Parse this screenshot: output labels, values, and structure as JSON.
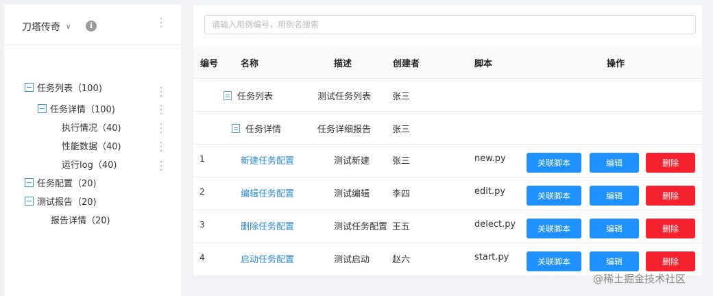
{
  "project": {
    "name": "刀塔传奇",
    "chevron_icon": "chevron-down-icon",
    "info_icon": "info-icon"
  },
  "tree": [
    {
      "label": "任务列表（100)",
      "toggle": "collapse-icon"
    },
    {
      "label": "任务详情（100)",
      "toggle": "collapse-icon"
    },
    {
      "label": "执行情况（40)"
    },
    {
      "label": "性能数据（40)"
    },
    {
      "label": "运行log（40)"
    },
    {
      "label": "任务配置（20)",
      "toggle": "collapse-icon"
    },
    {
      "label": "测试报告（20)",
      "toggle": "collapse-icon"
    },
    {
      "label": "报告详情（20)"
    }
  ],
  "search": {
    "placeholder": "请输入用例编号，用例名搜索",
    "value": ""
  },
  "table": {
    "headers": [
      "编号",
      "名称",
      "描述",
      "创建者",
      "脚本",
      "操作"
    ],
    "folder_rows": [
      {
        "name": "任务列表",
        "desc": "测试任务列表",
        "creator": "张三"
      },
      {
        "name": "任务详情",
        "desc": "任务详细报告",
        "creator": "张三"
      }
    ],
    "rows": [
      {
        "id": "1",
        "name": "新建任务配置",
        "desc": "测试新建",
        "creator": "张三",
        "script": "new.py"
      },
      {
        "id": "2",
        "name": "编辑任务配置",
        "desc": "测试编辑",
        "creator": "李四",
        "script": "edit.py"
      },
      {
        "id": "3",
        "name": "删除任务配置",
        "desc": "测试任务配置",
        "creator": "王五",
        "script": "delect.py"
      },
      {
        "id": "4",
        "name": "启动任务配置",
        "desc": "测试启动",
        "creator": "赵六",
        "script": "start.py"
      }
    ],
    "actions": {
      "link": "关联脚本",
      "edit": "编辑",
      "delete": "删除"
    }
  },
  "watermark": "@稀土掘金技术社区",
  "colors": {
    "accent": "#1e90ff",
    "danger": "#f5222d",
    "link": "#2a8bd8",
    "tree_toggle": "#3a96dc"
  }
}
